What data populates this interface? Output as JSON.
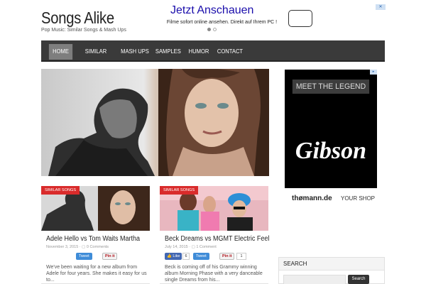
{
  "site": {
    "title": "Songs Alike",
    "description": "Pop Music: Similar Songs & Mash Ups"
  },
  "top_ad": {
    "headline": "Jetzt Anschauen",
    "body": "Filme sofort online ansehen. Direkt auf Ihrem PC !"
  },
  "nav": {
    "items": [
      "HOME",
      "SIMILAR SONGS",
      "MASH UPS",
      "SAMPLES",
      "HUMOR",
      "CONTACT"
    ],
    "active": "HOME"
  },
  "cards": [
    {
      "category": "SIMILAR SONGS",
      "title": "Adele Hello vs Tom Waits Martha",
      "date": "November 3, 2015",
      "comments": "0 Comments",
      "tweet_label": "Tweet",
      "pin_label": "Pin it",
      "excerpt": "We've been waiting for a new album from Adele for four years. She makes it easy for us to..."
    },
    {
      "category": "SIMILAR SONGS",
      "title": "Beck Dreams vs MGMT Electric Feel",
      "date": "July 14, 2015",
      "comments": "1 Comment",
      "like_label": "Like",
      "like_count": "6",
      "tweet_label": "Tweet",
      "pin_label": "Pin it",
      "pin_count": "1",
      "excerpt": "Beck is coming off of his Grammy winning album Morning Phase with a very danceable single Dreams from his..."
    }
  ],
  "side_ad": {
    "tagline": "MEET THE LEGEND",
    "logo_text": "Gibson",
    "store": "thømann.de",
    "cta": "YOUR SHOP"
  },
  "search_widget": {
    "heading": "SEARCH",
    "button": "Search"
  },
  "colors": {
    "nav_bg": "#3a3a3a",
    "nav_active": "#7e7e7e",
    "category_badge": "#d92b2b",
    "fb_like": "#4267b2",
    "tweet": "#3f8cd8"
  }
}
